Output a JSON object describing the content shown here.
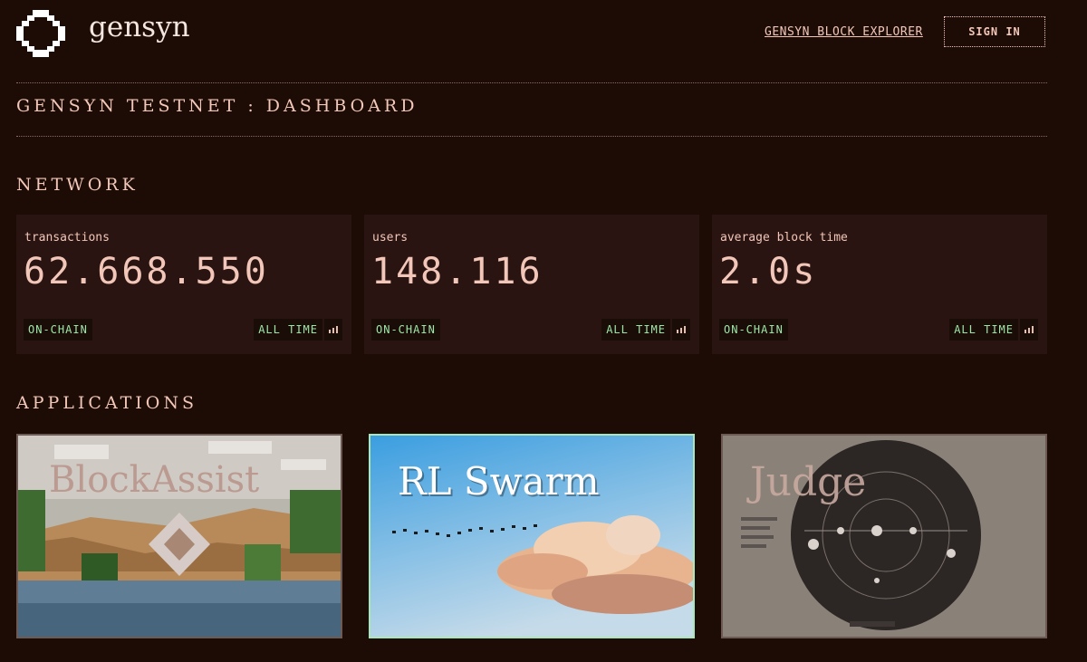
{
  "brand": {
    "name": "gensyn"
  },
  "nav": {
    "explorer_link": "GENSYN BLOCK EXPLORER",
    "sign_in": "SIGN IN"
  },
  "page": {
    "title": "GENSYN TESTNET : DASHBOARD"
  },
  "network": {
    "title": "NETWORK",
    "stats": [
      {
        "label": "transactions",
        "value": "62.668.550",
        "source_tag": "ON-CHAIN",
        "range_tag": "ALL TIME"
      },
      {
        "label": "users",
        "value": "148.116",
        "source_tag": "ON-CHAIN",
        "range_tag": "ALL TIME"
      },
      {
        "label": "average block time",
        "value": "2.0s",
        "source_tag": "ON-CHAIN",
        "range_tag": "ALL TIME"
      }
    ]
  },
  "applications": {
    "title": "APPLICATIONS",
    "items": [
      {
        "name": "BlockAssist"
      },
      {
        "name": "RL Swarm"
      },
      {
        "name": "Judge"
      }
    ]
  },
  "colors": {
    "background": "#1d0c05",
    "card": "#2a1411",
    "text": "#f2c7b9",
    "tag_text": "#9ee6a7"
  },
  "icons": {
    "logo": "gensyn-logo-icon",
    "chart": "bar-chart-icon"
  }
}
